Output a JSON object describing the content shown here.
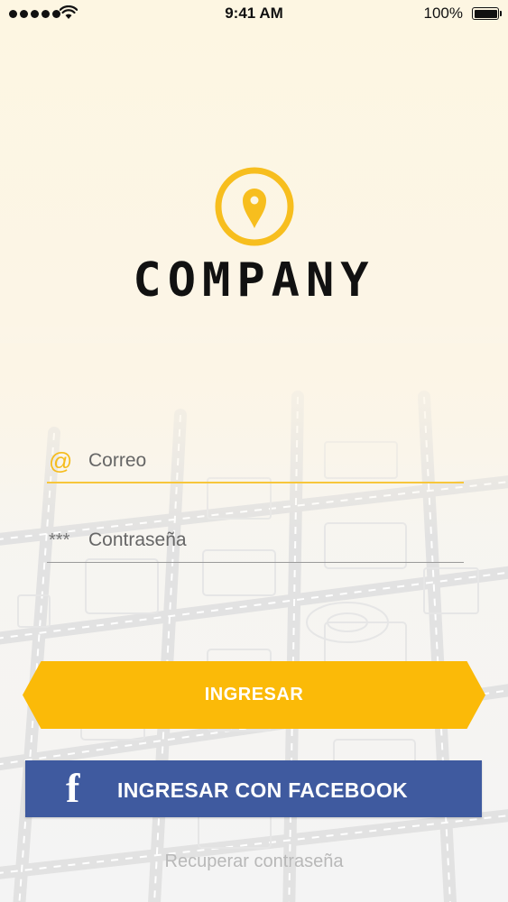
{
  "status_bar": {
    "time": "9:41 AM",
    "battery": "100%"
  },
  "brand": {
    "name": "COMPANY",
    "logo_icon": "location-pin-icon",
    "accent_color": "#F7BE1E"
  },
  "form": {
    "email": {
      "icon": "@",
      "placeholder": "Correo",
      "value": ""
    },
    "password": {
      "icon": "***",
      "placeholder": "Contraseña",
      "value": ""
    }
  },
  "actions": {
    "login_label": "INGRESAR",
    "login_color": "#FBBA08",
    "facebook_icon": "f",
    "facebook_label": "INGRESAR CON FACEBOOK",
    "facebook_color": "#3F5A9F",
    "recover_label": "Recuperar contraseña"
  }
}
